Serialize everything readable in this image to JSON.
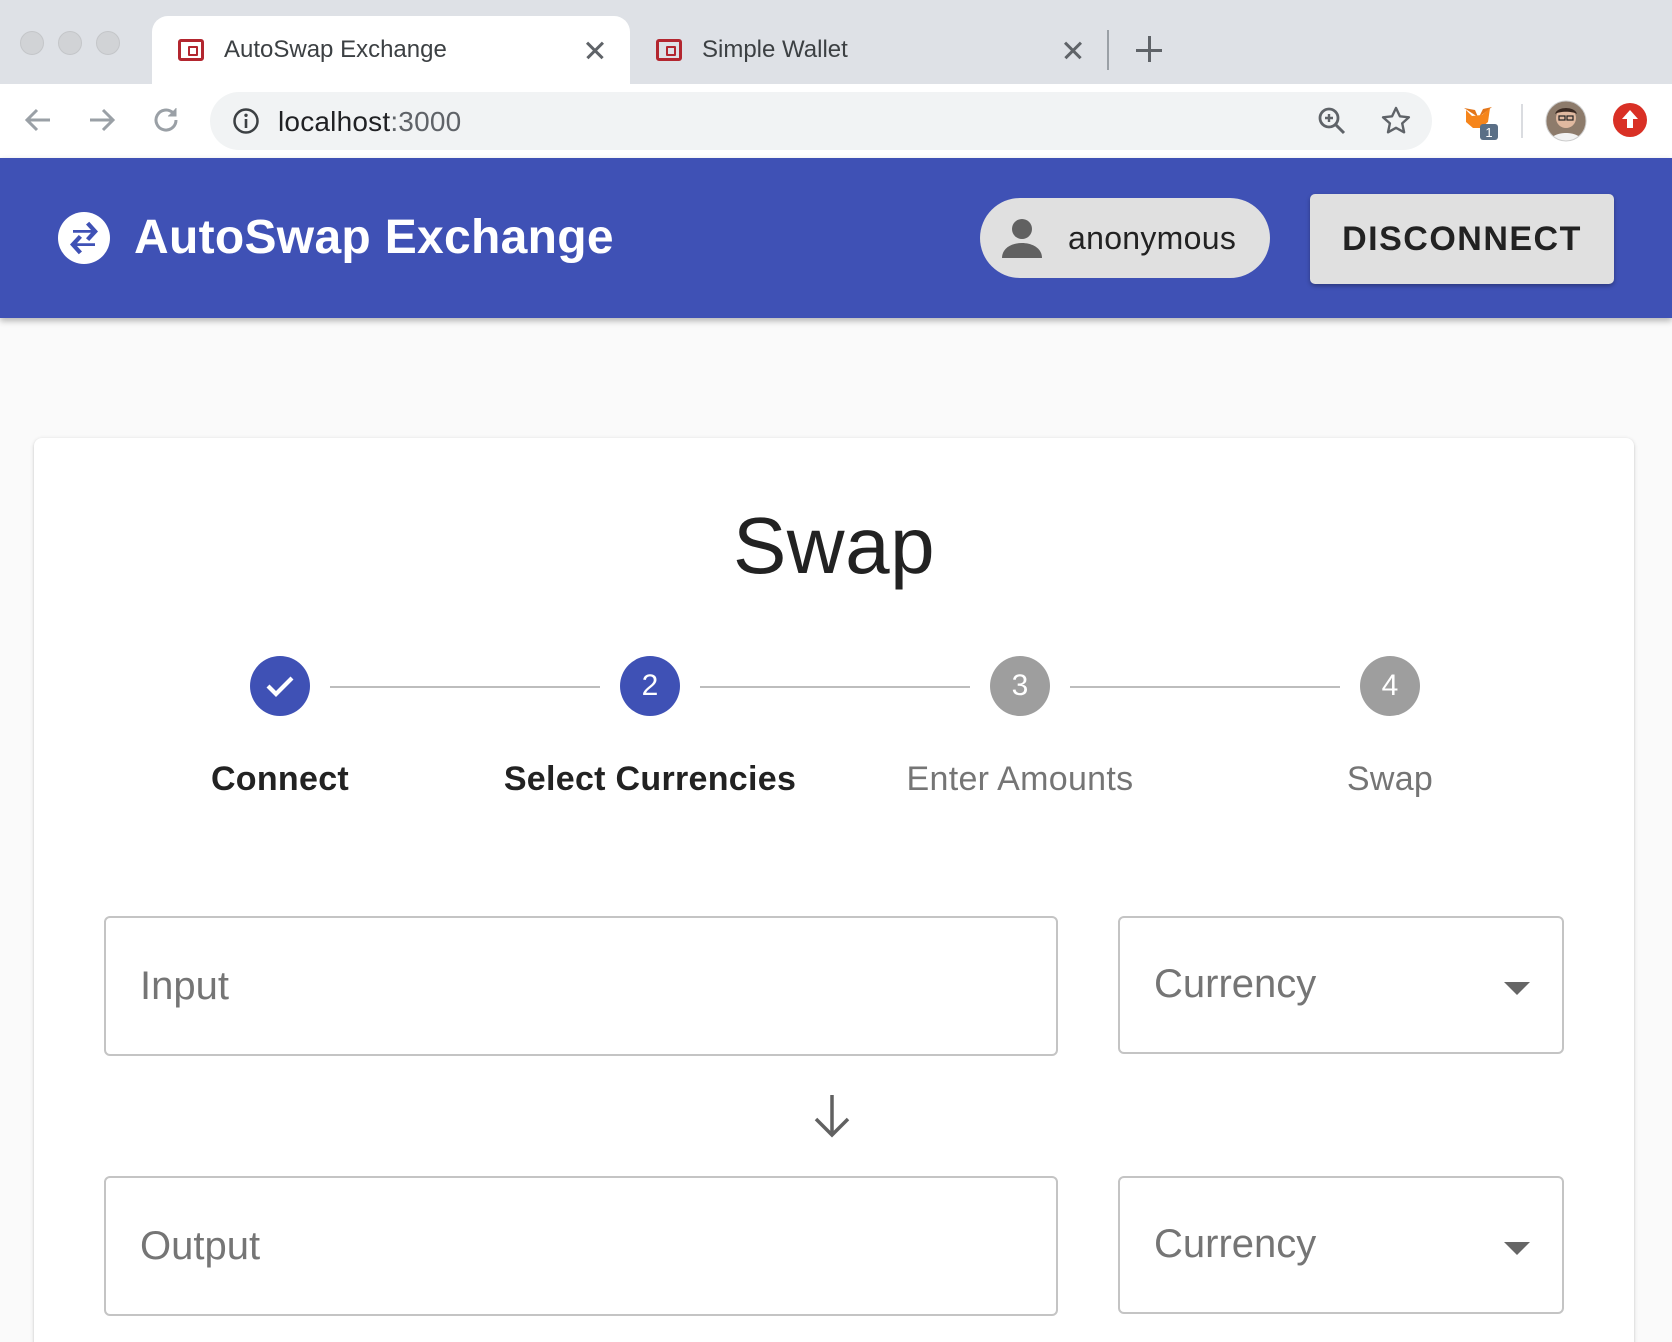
{
  "browser": {
    "tabs": [
      {
        "title": "AutoSwap Exchange",
        "active": true
      },
      {
        "title": "Simple Wallet",
        "active": false
      }
    ],
    "url_host": "localhost",
    "url_port": ":3000",
    "extension_badge": "1"
  },
  "header": {
    "title": "AutoSwap Exchange",
    "username": "anonymous",
    "disconnect_label": "DISCONNECT",
    "color": "#3f51b5"
  },
  "swap": {
    "title": "Swap",
    "steps": [
      {
        "number": "1",
        "label": "Connect",
        "state": "done"
      },
      {
        "number": "2",
        "label": "Select Currencies",
        "state": "current"
      },
      {
        "number": "3",
        "label": "Enter Amounts",
        "state": "pending"
      },
      {
        "number": "4",
        "label": "Swap",
        "state": "pending"
      }
    ],
    "input": {
      "placeholder": "Input",
      "value": ""
    },
    "input_currency": {
      "placeholder": "Currency",
      "selected": ""
    },
    "output": {
      "placeholder": "Output",
      "value": ""
    },
    "output_currency": {
      "placeholder": "Currency",
      "selected": ""
    }
  }
}
